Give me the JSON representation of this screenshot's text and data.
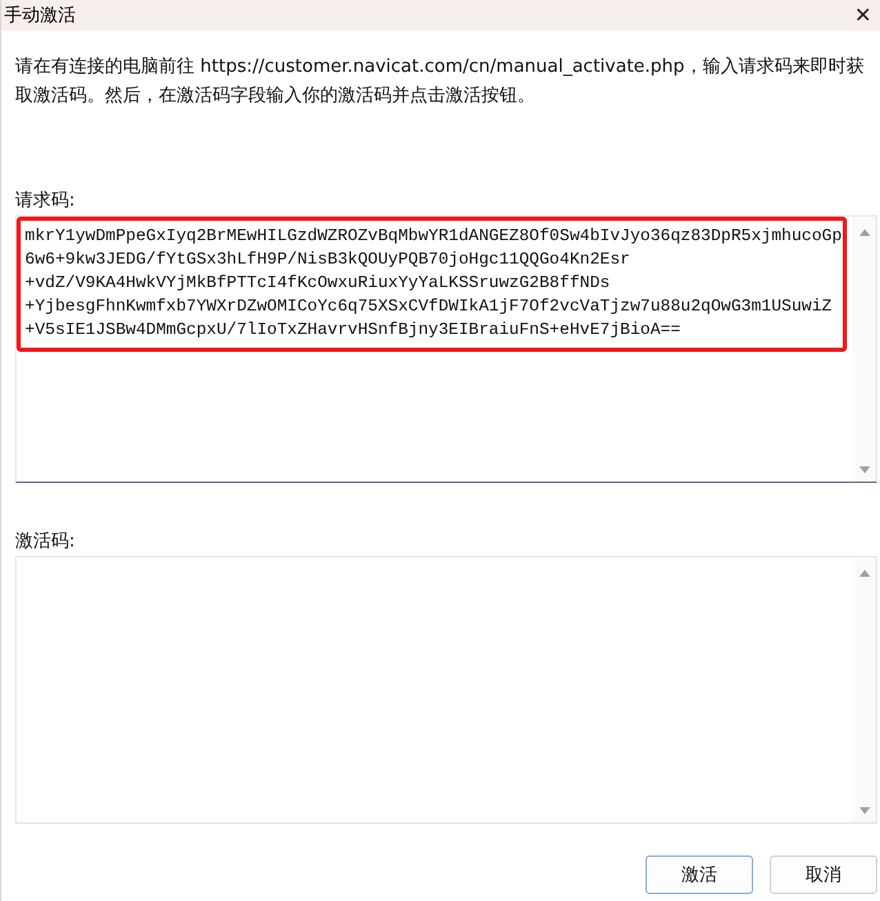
{
  "window": {
    "title": "手动激活",
    "close": "✕"
  },
  "instructions": "请在有连接的电脑前往 https://customer.navicat.com/cn/manual_activate.php，输入请求码来即时获取激活码。然后，在激活码字段输入你的激活码并点击激活按钮。",
  "request_code": {
    "label": "请求码:",
    "lines": [
      "mkrY1ywDmPpeGxIyq2BrMEwHILGzdWZROZvBqMbwYR1dANGEZ8Of0Sw4bIvJyo36qz83DpR5xjmhucoGp",
      "6w6+9kw3JEDG/fYtGSx3hLfH9P/NisB3kQOUyPQB70joHgc11QQGo4Kn2Esr",
      "+vdZ/V9KA4HwkVYjMkBfPTTcI4fKcOwxuRiuxYyYaLKSSruwzG2B8ffNDs",
      "+YjbesgFhnKwmfxb7YWXrDZwOMICoYc6q75XSxCVfDWIkA1jF7Of2vcVaTjzw7u88u2qOwG3m1USuwiZ",
      "+V5sIE1JSBw4DMmGcpxU/7lIoTxZHavrvHSnfBjny3EIBraiuFnS+eHvE7jBioA=="
    ],
    "highlighted": true
  },
  "activation_code": {
    "label": "激活码:"
  },
  "buttons": [
    {
      "label": "激活",
      "selected": true
    },
    {
      "label": "取消",
      "selected": false
    }
  ]
}
